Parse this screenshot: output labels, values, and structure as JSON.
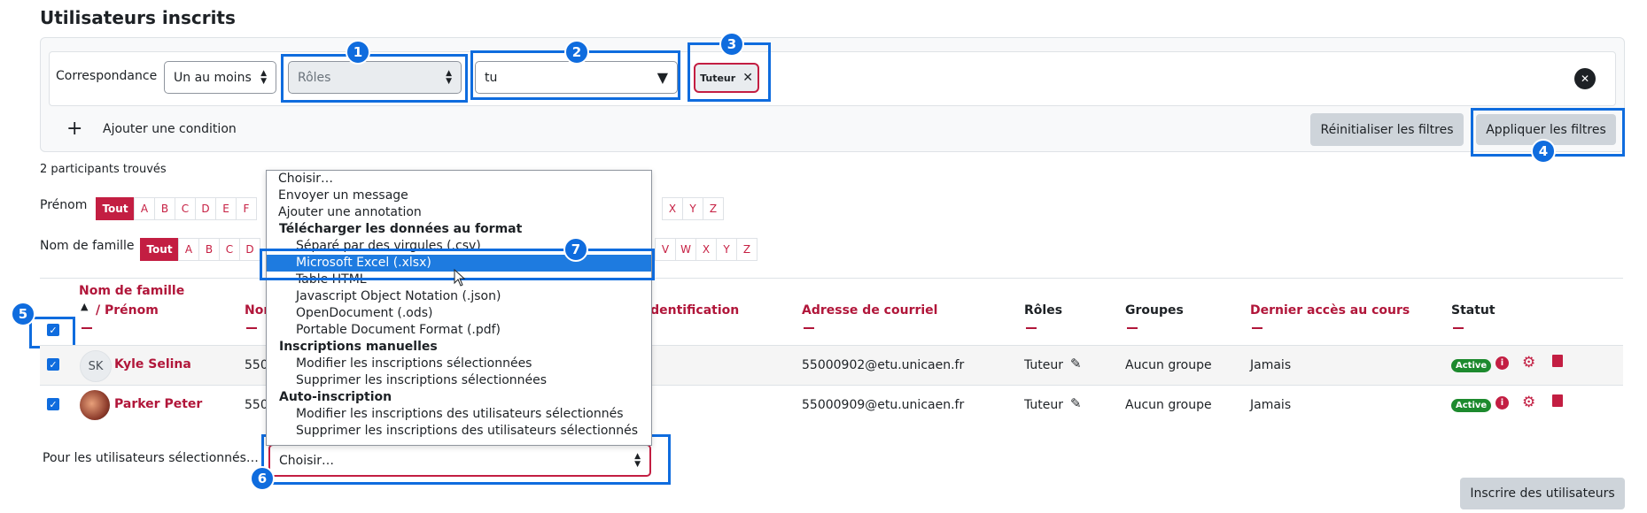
{
  "page_title": "Utilisateurs inscrits",
  "filter": {
    "match_label": "Correspondance",
    "match_value": "Un au moins",
    "type_value": "Rôles",
    "search_value": "tu",
    "chip_label": "Tuteur",
    "add_condition_label": "Ajouter une condition",
    "reset_label": "Réinitialiser les filtres",
    "apply_label": "Appliquer les filtres"
  },
  "participants_found": "2 participants trouvés",
  "initials": {
    "first_label": "Prénom",
    "last_label": "Nom de famille",
    "all_label": "Tout",
    "letters_left": [
      "A",
      "B",
      "C",
      "D",
      "E",
      "F"
    ],
    "first_letters_right": [
      "X",
      "Y",
      "Z"
    ],
    "last_letters_left": [
      "A",
      "B",
      "C",
      "D"
    ],
    "last_letters_right": [
      "V",
      "W",
      "X",
      "Y",
      "Z"
    ]
  },
  "table": {
    "col_lastname": "Nom de famille",
    "col_firstname": "/ Prénom",
    "col_nom_partial": "Nor",
    "col_id_partial": "'identification",
    "col_email": "Adresse de courriel",
    "col_roles": "Rôles",
    "col_groups": "Groupes",
    "col_last_access": "Dernier accès au cours",
    "col_status": "Statut",
    "sort_arrow": "▲",
    "rows": [
      {
        "initials": "SK",
        "name": "Kyle Selina",
        "id_partial": "550",
        "email": "55000902@etu.unicaen.fr",
        "role": "Tuteur",
        "group": "Aucun groupe",
        "last_access": "Jamais",
        "status": "Active"
      },
      {
        "initials": "",
        "name": "Parker Peter",
        "id_partial": "550",
        "email": "55000909@etu.unicaen.fr",
        "role": "Tuteur",
        "group": "Aucun groupe",
        "last_access": "Jamais",
        "status": "Active"
      }
    ]
  },
  "bulk": {
    "label": "Pour les utilisateurs sélectionnés…",
    "select_value": "Choisir…"
  },
  "enrol_button": "Inscrire des utilisateurs",
  "dropdown": {
    "items": [
      {
        "kind": "top",
        "label": "Choisir…"
      },
      {
        "kind": "top",
        "label": "Envoyer un message"
      },
      {
        "kind": "top",
        "label": "Ajouter une annotation"
      },
      {
        "kind": "group",
        "label": "Télécharger les données au format"
      },
      {
        "kind": "sub",
        "label": "Séparé par des virgules (.csv)"
      },
      {
        "kind": "sub",
        "label": "Microsoft Excel (.xlsx)",
        "selected": true
      },
      {
        "kind": "sub",
        "label": "Table HTML"
      },
      {
        "kind": "sub",
        "label": "Javascript Object Notation (.json)"
      },
      {
        "kind": "sub",
        "label": "OpenDocument (.ods)"
      },
      {
        "kind": "sub",
        "label": "Portable Document Format (.pdf)"
      },
      {
        "kind": "group",
        "label": "Inscriptions manuelles"
      },
      {
        "kind": "sub",
        "label": "Modifier les inscriptions sélectionnées"
      },
      {
        "kind": "sub",
        "label": "Supprimer les inscriptions sélectionnées"
      },
      {
        "kind": "group",
        "label": "Auto-inscription"
      },
      {
        "kind": "sub",
        "label": "Modifier les inscriptions des utilisateurs sélectionnés"
      },
      {
        "kind": "sub",
        "label": "Supprimer les inscriptions des utilisateurs sélectionnés"
      }
    ]
  },
  "badges": [
    "1",
    "2",
    "3",
    "4",
    "5",
    "6",
    "7"
  ],
  "colors": {
    "accent": "#0f6cde",
    "brand": "#c31e42",
    "success": "#1d8a2e"
  }
}
